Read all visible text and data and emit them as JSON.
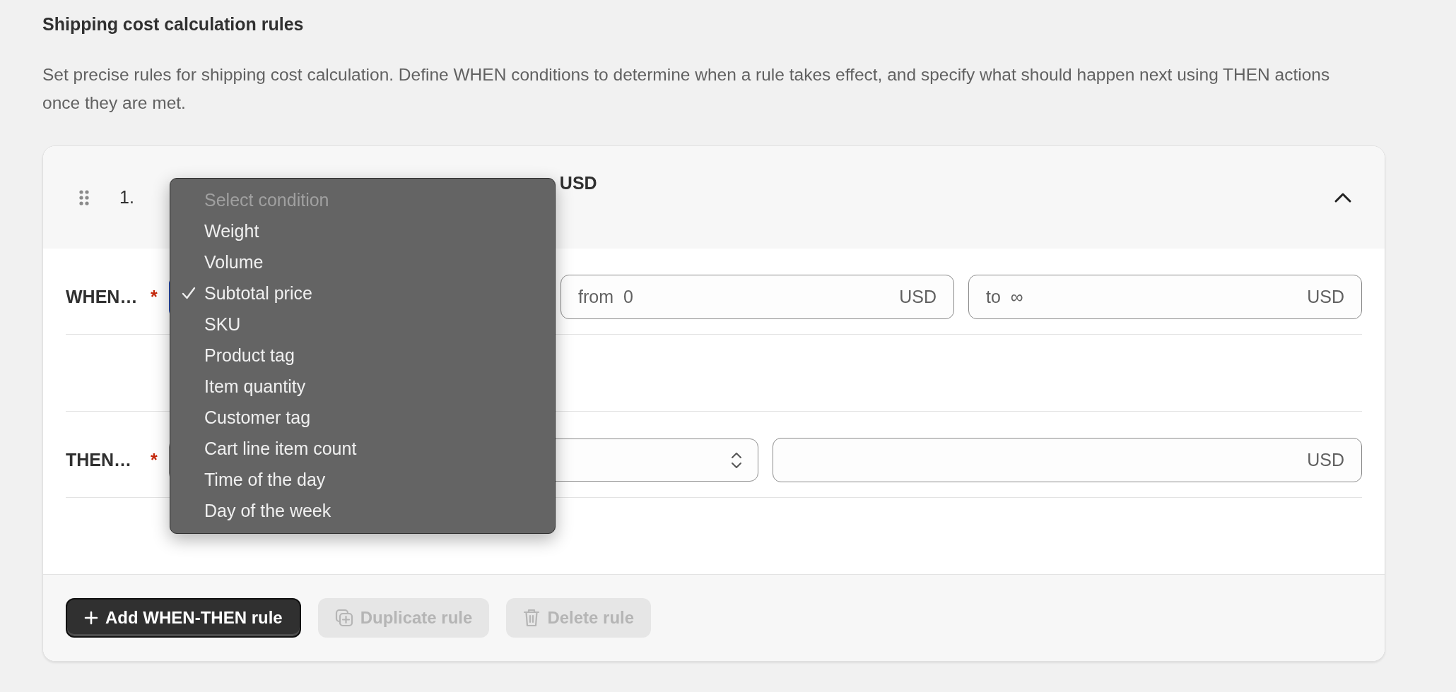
{
  "section": {
    "title": "Shipping cost calculation rules",
    "description": "Set precise rules for shipping cost calculation. Define WHEN conditions to determine when a rule takes effect, and specify what should happen next using THEN actions once they are met."
  },
  "rule": {
    "number": "1.",
    "summary": "USD",
    "expanded": true,
    "when": {
      "label": "WHEN…",
      "required_mark": "*",
      "condition_focused": true,
      "from": {
        "prefix": "from",
        "value": "0",
        "suffix": "USD"
      },
      "to": {
        "prefix": "to",
        "value": "∞",
        "suffix": "USD"
      }
    },
    "then": {
      "label": "THEN…",
      "required_mark": "*",
      "amount": {
        "suffix": "USD"
      }
    }
  },
  "dropdown": {
    "prompt": "Select condition",
    "options": [
      {
        "label": "Weight",
        "selected": false
      },
      {
        "label": "Volume",
        "selected": false
      },
      {
        "label": "Subtotal price",
        "selected": true
      },
      {
        "label": "SKU",
        "selected": false
      },
      {
        "label": "Product tag",
        "selected": false
      },
      {
        "label": "Item quantity",
        "selected": false
      },
      {
        "label": "Customer tag",
        "selected": false
      },
      {
        "label": "Cart line item count",
        "selected": false
      },
      {
        "label": "Time of the day",
        "selected": false
      },
      {
        "label": "Day of the week",
        "selected": false
      }
    ]
  },
  "buttons": [
    {
      "label": "Add WHEN-THEN rule",
      "kind": "add",
      "disabled": false
    },
    {
      "label": "Duplicate rule",
      "kind": "duplicate",
      "disabled": true
    },
    {
      "label": "Delete rule",
      "kind": "delete",
      "disabled": true
    }
  ]
}
